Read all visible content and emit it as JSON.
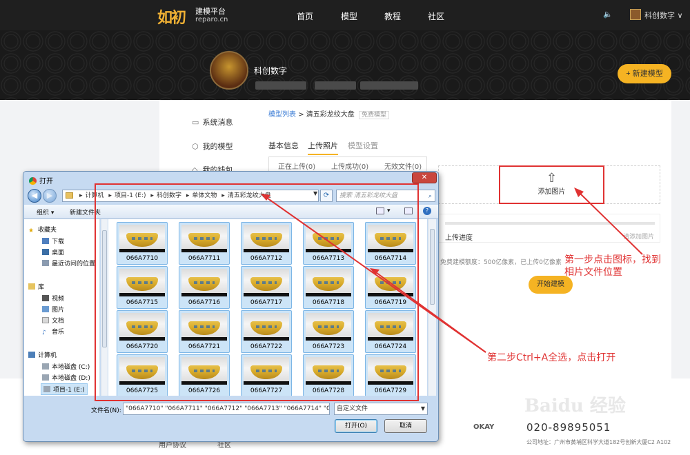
{
  "site": {
    "logo_text": "如初",
    "logo_title": "建模平台",
    "logo_domain": "reparo.cn",
    "nav": [
      "首页",
      "模型",
      "教程",
      "社区"
    ],
    "user_name": "科创数字",
    "user_caret": "∨"
  },
  "profile": {
    "name": "科创数字",
    "new_model_button": "+ 新建模型"
  },
  "sidebar": {
    "items": [
      {
        "icon": "message-icon",
        "glyph": "💬",
        "label": "系统消息"
      },
      {
        "icon": "cube-icon",
        "glyph": "⬡",
        "label": "我的模型"
      },
      {
        "icon": "wallet-icon",
        "glyph": "♦",
        "label": "我的钱包"
      }
    ]
  },
  "breadcrumb": {
    "root": "模型列表",
    "sep": ">",
    "current": "清五彩龙纹大盘",
    "badge": "免费模型"
  },
  "tabs": [
    "基本信息",
    "上传照片",
    "模型设置"
  ],
  "upload_tabs": [
    "正在上传(0)",
    "上传成功(0)",
    "无效文件(0)"
  ],
  "upload": {
    "add_image_label": "添加图片",
    "progress_label": "上传进度",
    "add_hint": "请添加图片",
    "quota_text": "免费建模额度：500亿像素，已上传0亿像素",
    "start_button": "开始建模"
  },
  "footer": {
    "phone": "020-89895051",
    "address": "公司地址：广州市黄埔区科学大道182号创新大厦C2 A102",
    "partner": "OKAY",
    "links": [
      "用户协议",
      "社区"
    ],
    "watermark": "Baidu 经验"
  },
  "annotations": {
    "step1": "第一步点击图标，找到相片文件位置",
    "step2": "第二步Ctrl+A全选，点击打开"
  },
  "dialog": {
    "title": "打开",
    "close": "✕",
    "path": [
      "计算机",
      "项目-1 (E:)",
      "科创数字",
      "单体文物",
      "清五彩龙纹大盘"
    ],
    "search_placeholder": "搜索 清五彩龙纹大盘",
    "organize": "组织 ▾",
    "new_folder": "新建文件夹",
    "nav": {
      "favorites": "收藏夹",
      "fav_items": [
        "下载",
        "桌面",
        "最近访问的位置"
      ],
      "library": "库",
      "lib_items": [
        "视频",
        "图片",
        "文档",
        "音乐"
      ],
      "computer": "计算机",
      "drives": [
        "本地磁盘 (C:)",
        "本地磁盘 (D:)",
        "项目-1 (E:)"
      ]
    },
    "files": [
      "066A7710",
      "066A7711",
      "066A7712",
      "066A7713",
      "066A7714",
      "066A7715",
      "066A7716",
      "066A7717",
      "066A7718",
      "066A7719",
      "066A7720",
      "066A7721",
      "066A7722",
      "066A7723",
      "066A7724",
      "066A7725",
      "066A7726",
      "066A7727",
      "066A7728",
      "066A7729"
    ],
    "filename_label": "文件名(N):",
    "filename_value": "\"066A7710\" \"066A7711\" \"066A7712\" \"066A7713\" \"066A7714\" \"066A",
    "filter": "自定义文件",
    "open_button": "打开(O)",
    "cancel_button": "取消"
  },
  "colors": {
    "accent": "#f5b323",
    "annotation": "#e03232",
    "link": "#3a7bd5",
    "selection": "#cce4f7"
  }
}
